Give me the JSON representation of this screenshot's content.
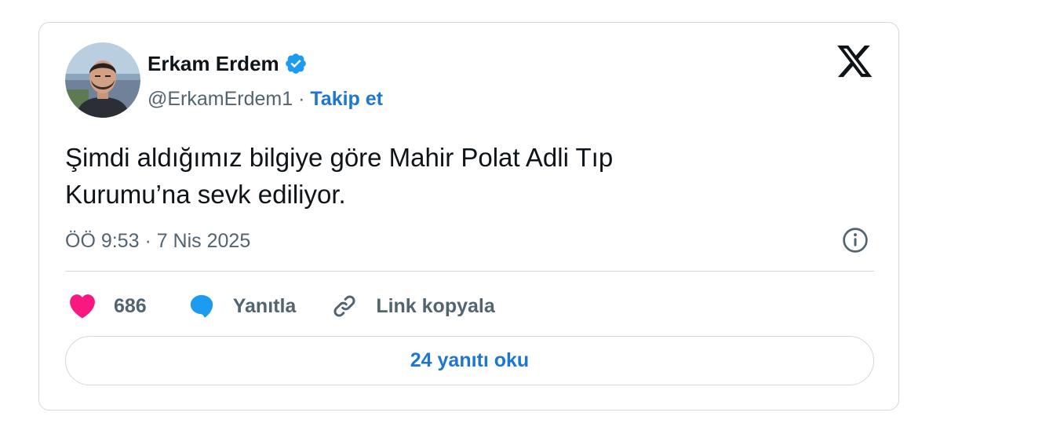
{
  "author": {
    "name": "Erkam Erdem",
    "handle": "@ErkamErdem1",
    "separator": "·",
    "follow_label": "Takip et"
  },
  "tweet": {
    "text_line1": "Şimdi aldığımız bilgiye göre Mahir Polat Adli Tıp",
    "text_line2": "Kurumu’na sevk ediliyor.",
    "timestamp": "ÖÖ 9:53 · 7 Nis 2025"
  },
  "actions": {
    "like_count": "686",
    "reply_label": "Yanıtla",
    "copy_link_label": "Link kopyala"
  },
  "read_replies_label": "24 yanıtı oku",
  "colors": {
    "accent_blue": "#1d75d4",
    "verified_blue": "#1d9bf0",
    "like_pink": "#f91880",
    "text_primary": "#0f1419",
    "text_secondary": "#536471",
    "border": "#cfd9de"
  },
  "icons": {
    "brand": "x-logo-icon",
    "verified": "verified-badge-icon",
    "info": "info-icon",
    "like": "heart-icon",
    "reply": "speech-bubble-icon",
    "copy_link": "link-icon"
  }
}
